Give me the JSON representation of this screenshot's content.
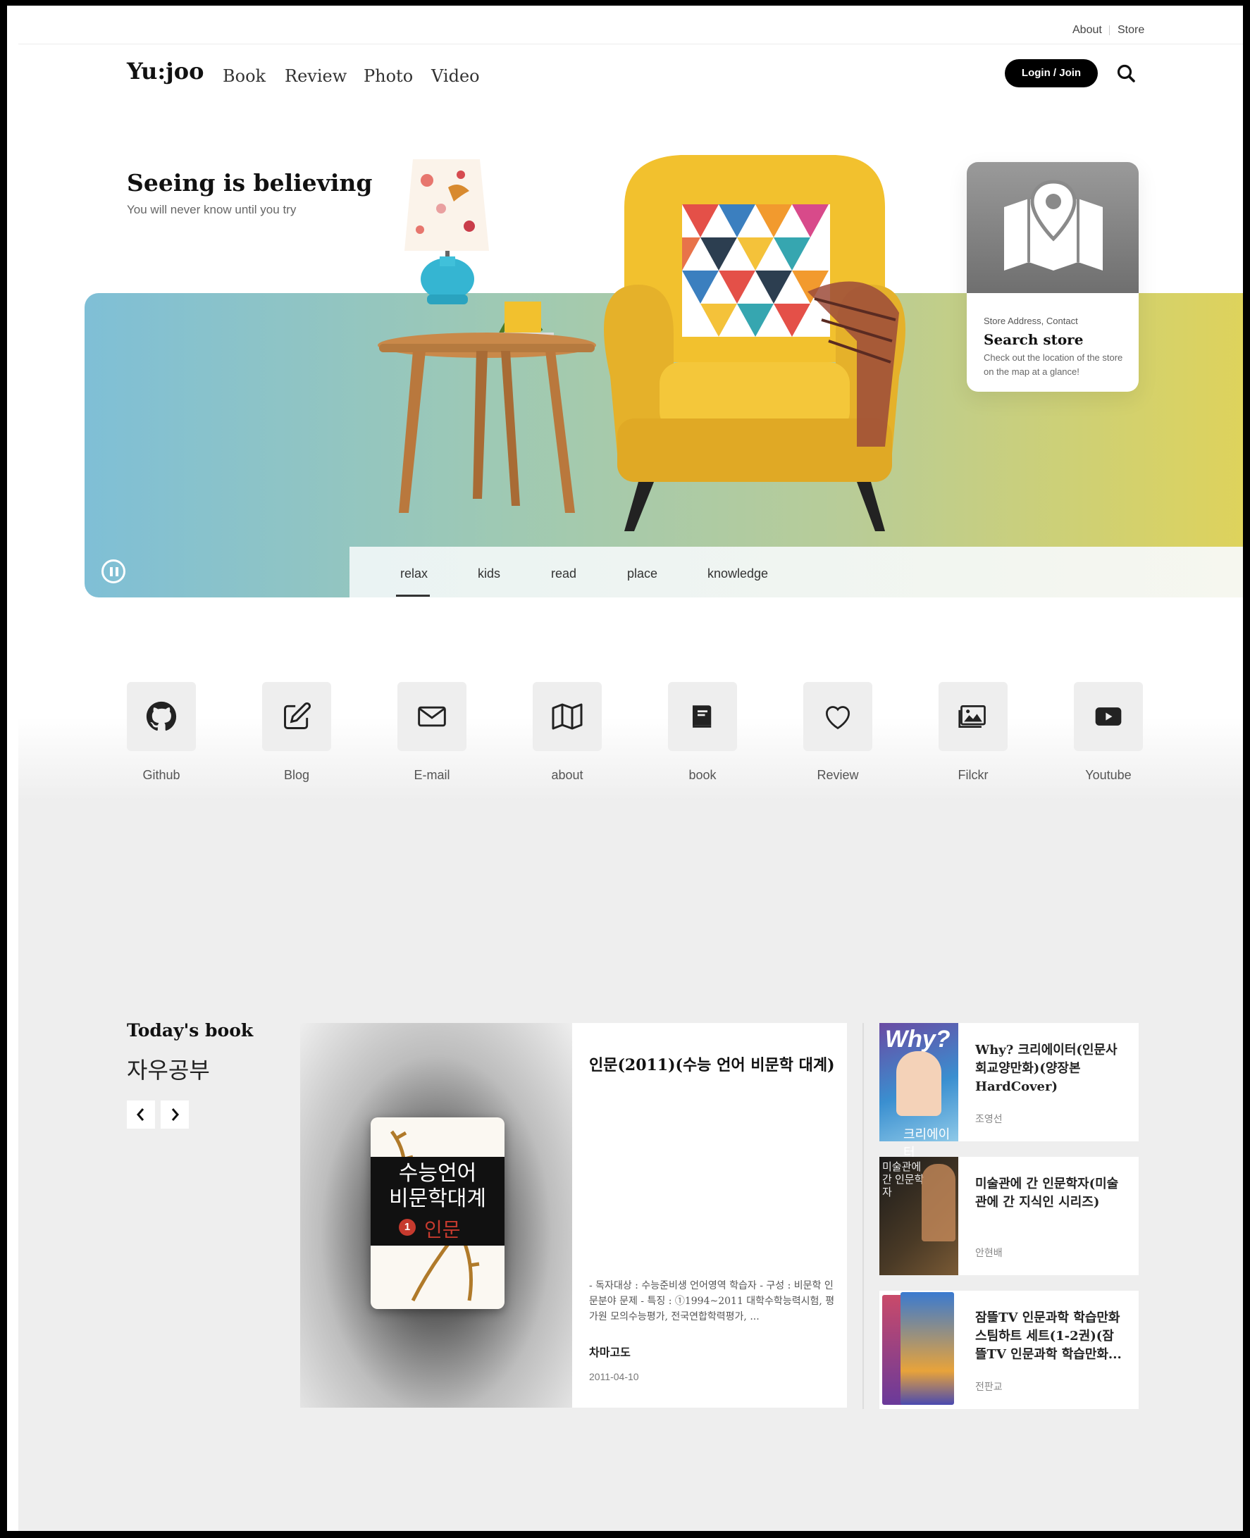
{
  "utility_nav": {
    "about": "About",
    "store": "Store"
  },
  "header": {
    "logo": "Yu:joo",
    "nav": [
      "Book",
      "Review",
      "Photo",
      "Video"
    ],
    "login_label": "Login / Join"
  },
  "hero": {
    "title": "Seeing is believing",
    "subtitle": "You will never know until you try",
    "tabs": [
      "relax",
      "kids",
      "read",
      "place",
      "knowledge"
    ],
    "active_tab": "relax"
  },
  "store_card": {
    "eyebrow": "Store Address, Contact",
    "title": "Search store",
    "description": "Check out the location of the store on the map at a glance!"
  },
  "shortcuts": [
    {
      "label": "Github",
      "icon": "github-icon"
    },
    {
      "label": "Blog",
      "icon": "edit-icon"
    },
    {
      "label": "E-mail",
      "icon": "mail-icon"
    },
    {
      "label": "about",
      "icon": "map-icon"
    },
    {
      "label": "book",
      "icon": "book-icon"
    },
    {
      "label": "Review",
      "icon": "heart-icon"
    },
    {
      "label": "Filckr",
      "icon": "image-icon"
    },
    {
      "label": "Youtube",
      "icon": "youtube-icon"
    }
  ],
  "todays_book": {
    "heading": "Today's book",
    "subheading": "자우공부",
    "featured": {
      "title": "인문(2011)(수능 언어 비문학 대계)",
      "description": "- 독자대상 : 수능준비생 언어영역 학습자 - 구성 : 비문학 인문분야 문제 - 특징 : ①1994~2011 대학수학능력시험, 평가원 모의수능평가, 전국연합학력평가, ...",
      "author": "차마고도",
      "date": "2011-04-10",
      "cover_text": {
        "line1": "수능언어",
        "line2": "비문학대계",
        "number": "1",
        "subject": "인문"
      }
    },
    "side_books": [
      {
        "title": "Why? 크리에이터(인문사회교양만화)(양장본 HardCover)",
        "author": "조영선",
        "cover_text": "Why?",
        "cover_caption": "크리에이터"
      },
      {
        "title": "미술관에 간 인문학자(미술관에 간 지식인 시리즈)",
        "author": "안현배",
        "cover_text": "미술관에 간 인문학자",
        "cover_caption": ""
      },
      {
        "title": "잠뜰TV 인문과학 학습만화 스팀하트 세트(1-2권)(잠뜰TV 인문과학 학습만화...",
        "author": "전판교",
        "cover_text": "",
        "cover_caption": ""
      }
    ]
  },
  "colors": {
    "accent": "#000000",
    "hero_left": "#7fbfd6",
    "hero_right": "#dfd35a",
    "chair": "#f2c12e",
    "panel_bg": "#eeeeee"
  }
}
